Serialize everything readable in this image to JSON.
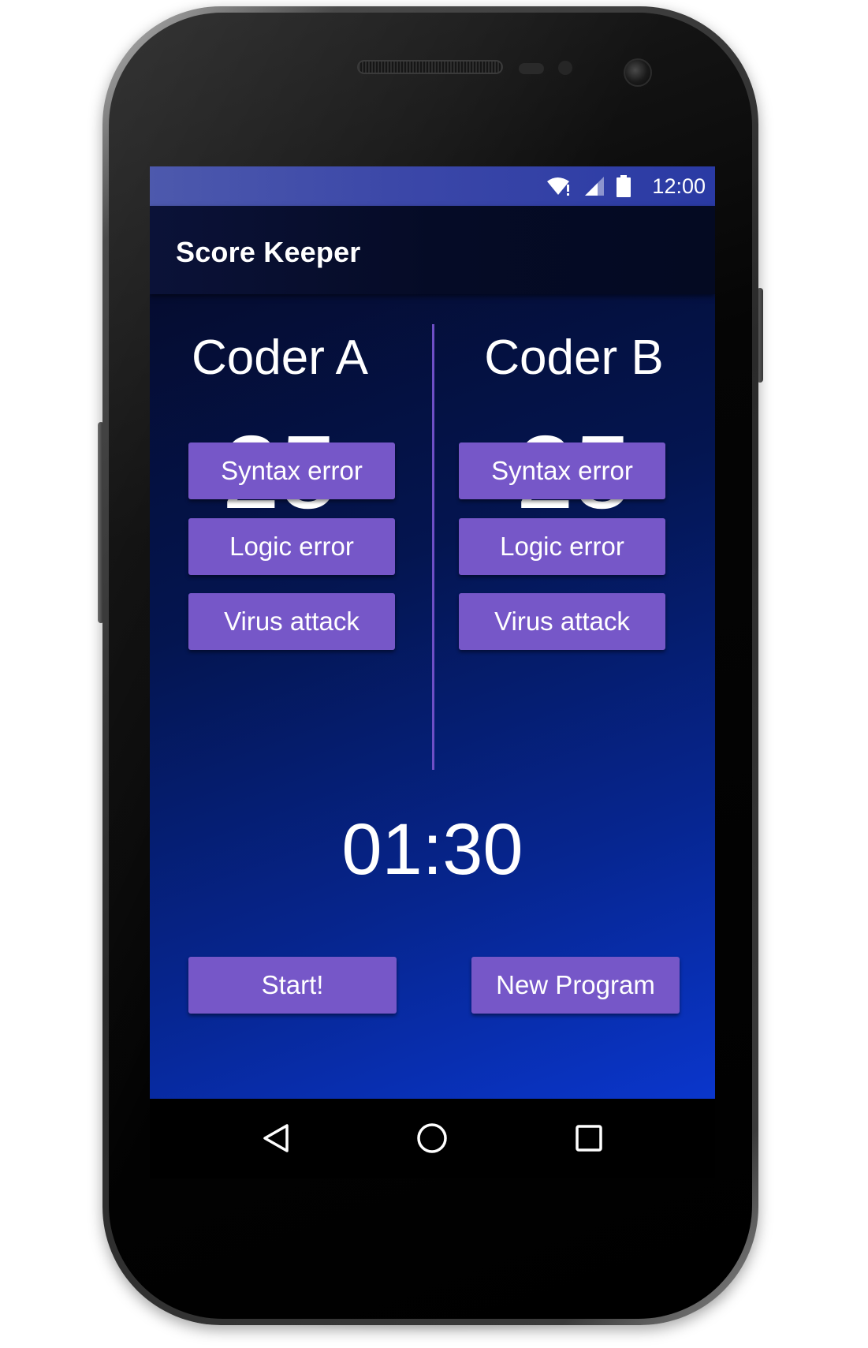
{
  "status_bar": {
    "time": "12:00",
    "icons": [
      "wifi-icon",
      "signal-icon",
      "battery-icon"
    ]
  },
  "app_bar": {
    "title": "Score Keeper"
  },
  "teams": [
    {
      "name": "Coder A",
      "score": "25",
      "buttons": {
        "syntax": "Syntax error",
        "logic": "Logic error",
        "virus": "Virus attack"
      }
    },
    {
      "name": "Coder B",
      "score": "25",
      "buttons": {
        "syntax": "Syntax error",
        "logic": "Logic error",
        "virus": "Virus attack"
      }
    }
  ],
  "timer": "01:30",
  "actions": {
    "start": "Start!",
    "new_program": "New Program"
  },
  "nav_bar": {
    "icons": [
      "back-icon",
      "home-icon",
      "recent-apps-icon"
    ]
  },
  "colors": {
    "button": "#7657c8",
    "divider": "#6f4fc6",
    "status_bar": "#3b47a8",
    "app_bar": "#060c2a",
    "background_top": "#050c30",
    "background_bottom": "#0a36cc",
    "text": "#ffffff"
  }
}
